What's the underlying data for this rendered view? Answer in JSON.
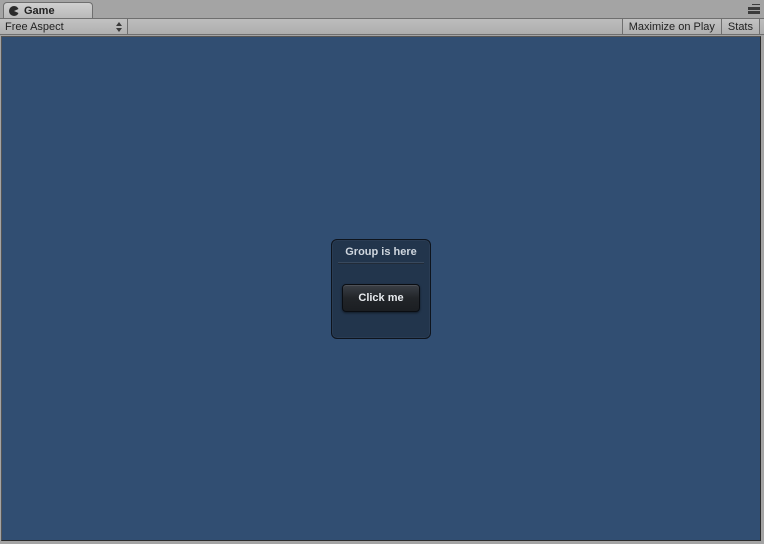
{
  "tab": {
    "label": "Game"
  },
  "toolbar": {
    "aspect_selected": "Free Aspect",
    "maximize_label": "Maximize on Play",
    "stats_label": "Stats"
  },
  "group": {
    "title": "Group is here",
    "button_label": "Click me"
  }
}
